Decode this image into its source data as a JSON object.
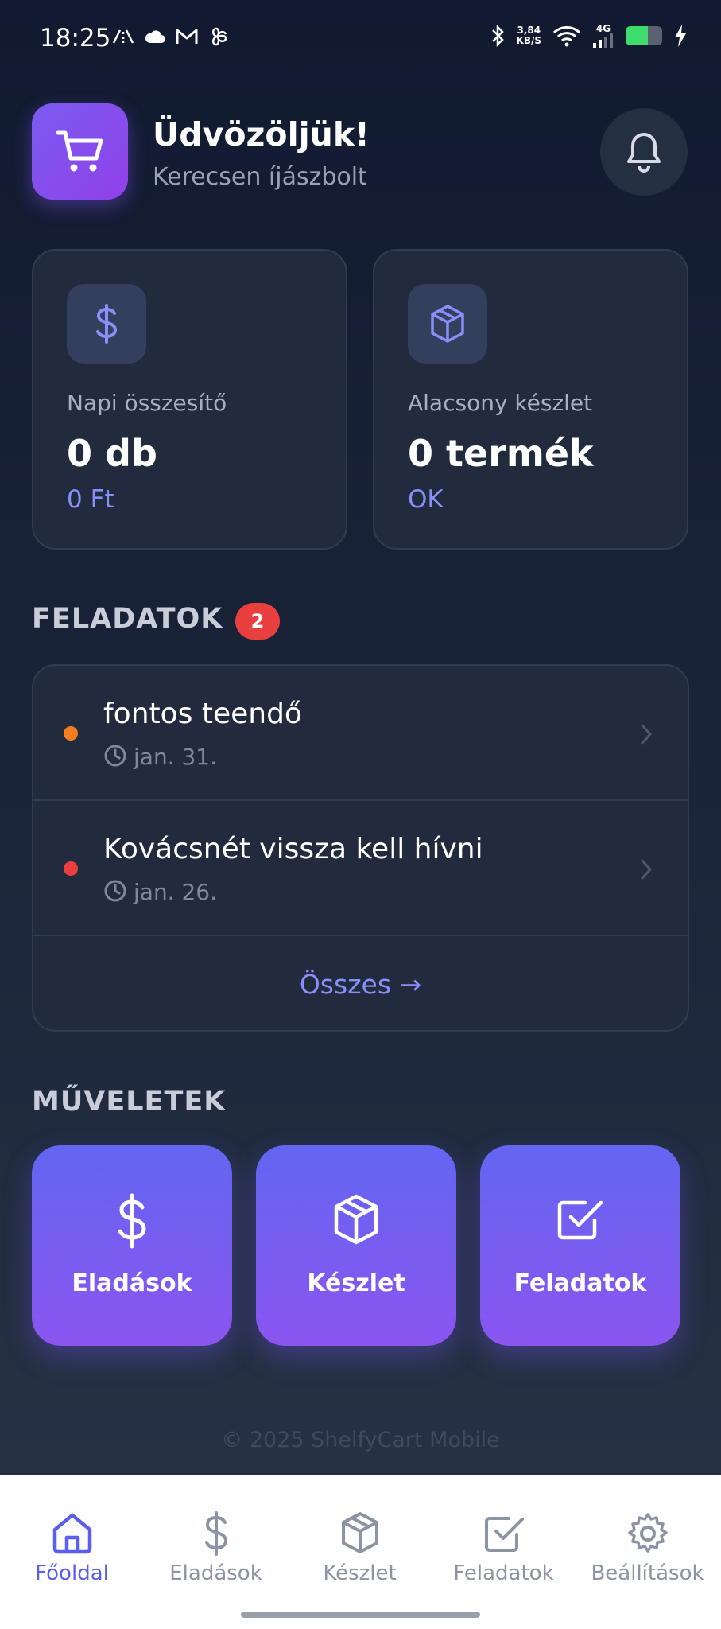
{
  "status_bar": {
    "time": "18:25",
    "net_speed_value": "3,84",
    "net_speed_unit": "KB/S",
    "network": "4G"
  },
  "header": {
    "title": "Üdvözöljük!",
    "subtitle": "Kerecsen íjászbolt"
  },
  "stats": {
    "daily": {
      "label": "Napi összesítő",
      "value": "0 db",
      "sub": "0 Ft"
    },
    "low_stock": {
      "label": "Alacsony készlet",
      "value": "0 termék",
      "sub": "OK"
    }
  },
  "tasks": {
    "title": "FELADATOK",
    "count": "2",
    "items": [
      {
        "title": "fontos teendő",
        "date": "jan. 31.",
        "color": "#f57c1f"
      },
      {
        "title": "Kovácsnét vissza kell hívni",
        "date": "jan. 26.",
        "color": "#e9403f"
      }
    ],
    "see_all": "Összes →"
  },
  "actions": {
    "title": "MŰVELETEK",
    "items": [
      {
        "label": "Eladások",
        "icon": "dollar-icon"
      },
      {
        "label": "Készlet",
        "icon": "box-icon"
      },
      {
        "label": "Feladatok",
        "icon": "checkbox-icon"
      }
    ]
  },
  "footer": {
    "copyright": "© 2025 ShelfyCart Mobile"
  },
  "bottom_nav": {
    "items": [
      {
        "label": "Főoldal",
        "icon": "home-icon",
        "active": true
      },
      {
        "label": "Eladások",
        "icon": "dollar-icon"
      },
      {
        "label": "Készlet",
        "icon": "box-icon"
      },
      {
        "label": "Feladatok",
        "icon": "checkbox-icon"
      },
      {
        "label": "Beállítások",
        "icon": "gear-icon"
      }
    ]
  },
  "colors": {
    "accent": "#6366f1",
    "accent_alt": "#8b55f0",
    "background": "#1a2438",
    "card": "#222b3d",
    "danger": "#e9403f",
    "warning": "#f57c1f"
  }
}
